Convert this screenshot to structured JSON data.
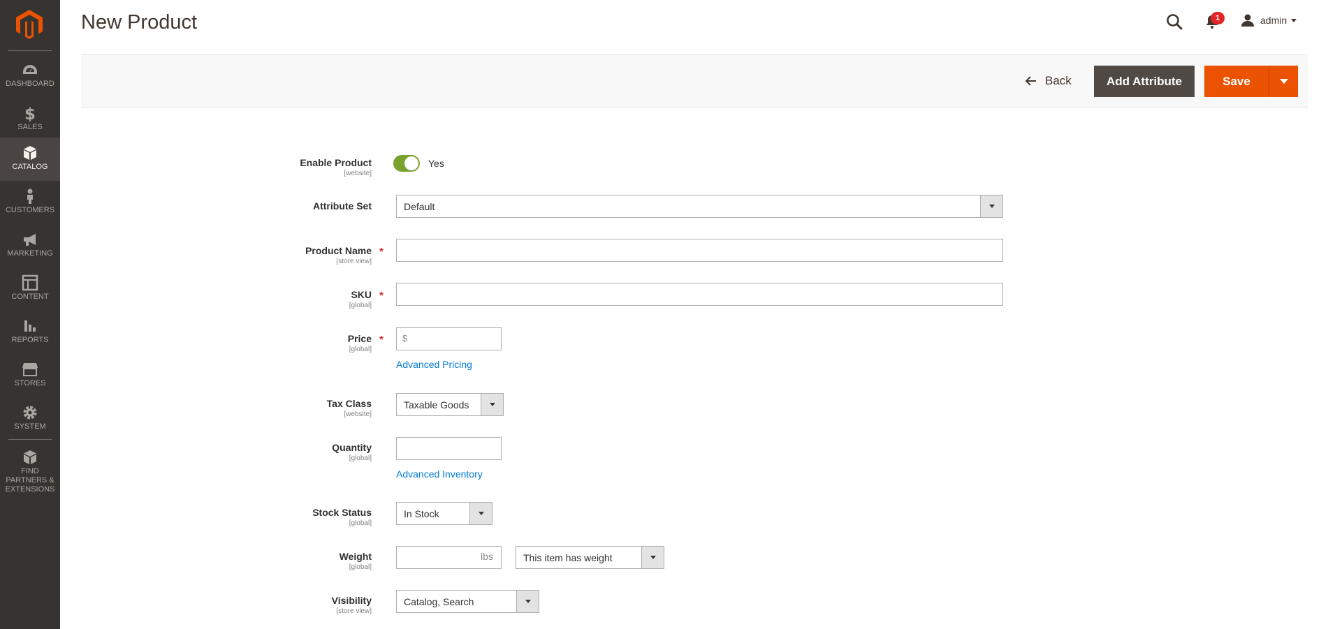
{
  "page": {
    "title": "New Product"
  },
  "header": {
    "notification_count": "1",
    "user_name": "admin"
  },
  "sidebar": {
    "items": [
      {
        "label": "DASHBOARD",
        "icon": "dashboard-icon"
      },
      {
        "label": "SALES",
        "icon": "dollar-icon"
      },
      {
        "label": "CATALOG",
        "icon": "catalog-box-icon"
      },
      {
        "label": "CUSTOMERS",
        "icon": "customer-person-icon"
      },
      {
        "label": "MARKETING",
        "icon": "megaphone-icon"
      },
      {
        "label": "CONTENT",
        "icon": "content-layout-icon"
      },
      {
        "label": "REPORTS",
        "icon": "bar-chart-icon"
      },
      {
        "label": "STORES",
        "icon": "storefront-icon"
      },
      {
        "label": "SYSTEM",
        "icon": "gear-icon"
      },
      {
        "label": "FIND PARTNERS & EXTENSIONS",
        "icon": "extensions-box-icon"
      }
    ],
    "active": "CATALOG"
  },
  "actions": {
    "back_label": "Back",
    "add_attribute_label": "Add Attribute",
    "save_label": "Save"
  },
  "form": {
    "enable_product": {
      "label": "Enable Product",
      "scope": "[website]",
      "value": "Yes",
      "enabled": true
    },
    "attribute_set": {
      "label": "Attribute Set",
      "value": "Default"
    },
    "product_name": {
      "label": "Product Name",
      "scope": "[store view]",
      "required": "*",
      "value": ""
    },
    "sku": {
      "label": "SKU",
      "scope": "[global]",
      "required": "*",
      "value": ""
    },
    "price": {
      "label": "Price",
      "scope": "[global]",
      "required": "*",
      "currency": "$",
      "value": "",
      "advanced_link": "Advanced Pricing"
    },
    "tax_class": {
      "label": "Tax Class",
      "scope": "[website]",
      "value": "Taxable Goods"
    },
    "quantity": {
      "label": "Quantity",
      "scope": "[global]",
      "value": "",
      "advanced_link": "Advanced Inventory"
    },
    "stock_status": {
      "label": "Stock Status",
      "scope": "[global]",
      "value": "In Stock"
    },
    "weight": {
      "label": "Weight",
      "scope": "[global]",
      "unit": "lbs",
      "value": "",
      "has_weight": "This item has weight"
    },
    "visibility": {
      "label": "Visibility",
      "scope": "[store view]",
      "value": "Catalog, Search"
    }
  },
  "colors": {
    "sidebar_bg": "#373330",
    "accent_orange": "#eb5202",
    "secondary_button": "#514943",
    "toggle_on": "#79a22e",
    "link": "#007bdb",
    "required": "#e02b27"
  }
}
